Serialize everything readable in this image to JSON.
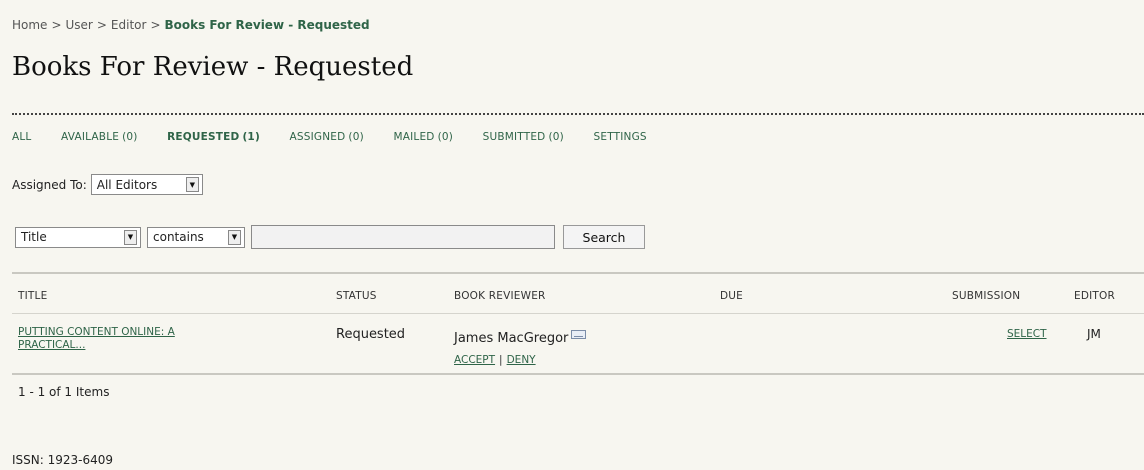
{
  "breadcrumb": {
    "items": [
      "Home",
      "User",
      "Editor"
    ],
    "separator": ">",
    "current": "Books For Review - Requested"
  },
  "page_title": "Books For Review - Requested",
  "tabs": [
    {
      "label": "ALL",
      "count": ""
    },
    {
      "label": "AVAILABLE",
      "count": "(0)"
    },
    {
      "label": "REQUESTED",
      "count": "(1)",
      "active": true
    },
    {
      "label": "ASSIGNED",
      "count": "(0)"
    },
    {
      "label": "MAILED",
      "count": "(0)"
    },
    {
      "label": "SUBMITTED",
      "count": "(0)"
    },
    {
      "label": "SETTINGS",
      "count": ""
    }
  ],
  "assigned_to": {
    "label": "Assigned To:",
    "selected": "All Editors"
  },
  "search": {
    "field_selected": "Title",
    "operator_selected": "contains",
    "query": "",
    "button_label": "Search"
  },
  "table": {
    "columns": [
      "TITLE",
      "STATUS",
      "BOOK REVIEWER",
      "DUE",
      "SUBMISSION",
      "EDITOR"
    ],
    "rows": [
      {
        "title_line1": "PUTTING CONTENT ONLINE: A",
        "title_line2": "PRACTICAL...",
        "status": "Requested",
        "reviewer": "James MacGregor",
        "reviewer_icon": "mail-icon",
        "accept_label": "ACCEPT",
        "deny_label": "DENY",
        "due": "",
        "submission": "SELECT",
        "editor": "JM"
      }
    ]
  },
  "pagination": "1 - 1 of 1 Items",
  "footer": {
    "issn": "ISSN: 1923-6409"
  },
  "colors": {
    "link": "#2f6448",
    "background": "#f7f6f0"
  }
}
